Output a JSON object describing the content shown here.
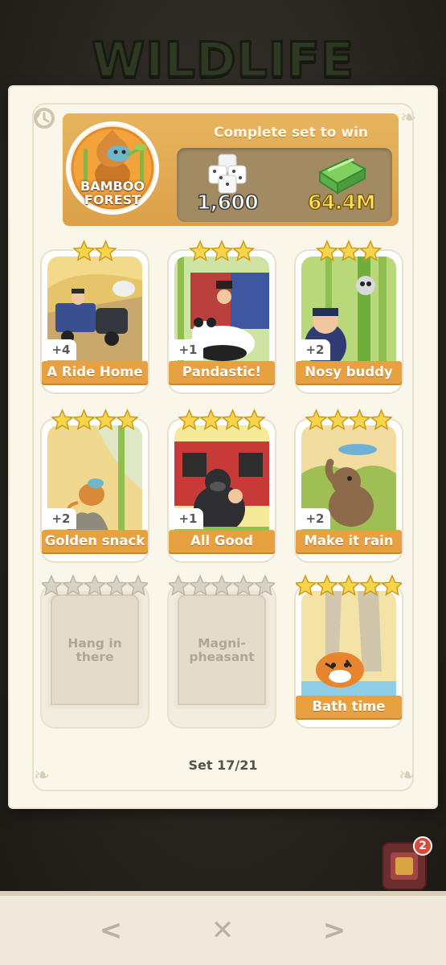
{
  "album": {
    "title": "WILDLIFE"
  },
  "set": {
    "name_line1": "BAMBOO",
    "name_line2": "FOREST",
    "complete_text": "Complete set to win",
    "rewards": [
      {
        "icon": "dice-icon",
        "value": "1,600"
      },
      {
        "icon": "cash-icon",
        "value": "64.4M"
      }
    ],
    "progress": "Set 17/21"
  },
  "cards": [
    {
      "name": "A Ride Home",
      "stars": 2,
      "count": "+4",
      "collected": true,
      "art": "train"
    },
    {
      "name": "Pandastic!",
      "stars": 3,
      "count": "+1",
      "collected": true,
      "art": "panda"
    },
    {
      "name": "Nosy buddy",
      "stars": 3,
      "count": "+2",
      "collected": true,
      "art": "lemur"
    },
    {
      "name": "Golden snack",
      "stars": 4,
      "count": "+2",
      "collected": true,
      "art": "monkey"
    },
    {
      "name": "All Good",
      "stars": 4,
      "count": "+1",
      "collected": true,
      "art": "gorilla"
    },
    {
      "name": "Make it rain",
      "stars": 4,
      "count": "+2",
      "collected": true,
      "art": "elephant"
    },
    {
      "name": "Hang in there",
      "stars": 5,
      "count": "",
      "collected": false,
      "art": ""
    },
    {
      "name": "Magni-pheasant",
      "stars": 5,
      "count": "",
      "collected": false,
      "art": ""
    },
    {
      "name": "Bath time",
      "stars": 5,
      "count": "",
      "collected": true,
      "art": "tiger"
    }
  ],
  "empty_labels": {
    "hang_l1": "Hang in",
    "hang_l2": "there",
    "mag_l1": "Magni-",
    "mag_l2": "pheasant"
  },
  "album_button": {
    "badge": "2"
  },
  "nav": {
    "prev": "<",
    "close": "✕",
    "next": ">"
  },
  "colors": {
    "banner": "#e0a84f",
    "label": "#e7a141",
    "star": "#f7d54a",
    "empty_star": "#d8d2c3"
  }
}
